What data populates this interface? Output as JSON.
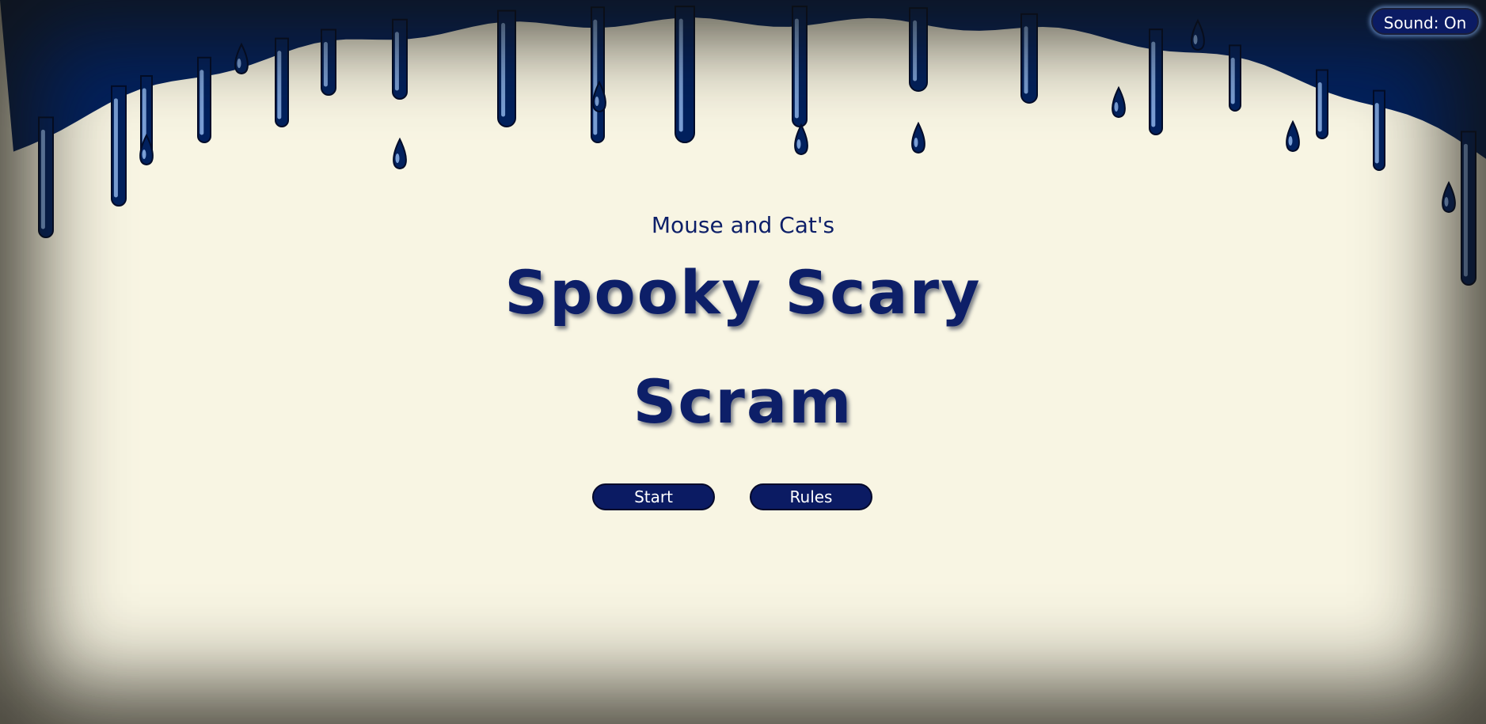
{
  "sound_button": {
    "label": "Sound: On"
  },
  "title": {
    "subtitle": "Mouse and Cat's",
    "line1": "Spooky Scary",
    "line2": "Scram"
  },
  "menu": {
    "start_label": "Start",
    "rules_label": "Rules"
  },
  "colors": {
    "background": "#f8f5e3",
    "slime": "#02215e",
    "slime_highlight": "#7a9fd6",
    "text": "#0d1f68",
    "button_fill": "#0b1b63"
  }
}
